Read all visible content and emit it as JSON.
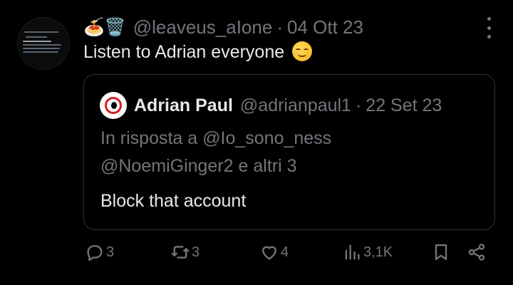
{
  "author": {
    "display_name": "🍝🗑️",
    "handle": "@leaveus_aIone",
    "date": "04 Ott 23"
  },
  "separator": "·",
  "tweet": {
    "text": "Listen to Adrian everyone",
    "emoji_icon": "relieved-face-icon"
  },
  "quoted": {
    "name": "Adrian Paul",
    "handle": "@adrianpaul1",
    "date": "22 Set 23",
    "reply_line1": "In risposta a @Io_sono_ness",
    "reply_line2": "@NoemiGinger2 e altri 3",
    "text": "Block that account"
  },
  "actions": {
    "replies": "3",
    "reposts": "3",
    "likes": "4",
    "views": "3,1K"
  },
  "colors": {
    "background": "#000000",
    "text": "#e7e9ea",
    "muted": "#71767b",
    "border": "#2f3336"
  }
}
